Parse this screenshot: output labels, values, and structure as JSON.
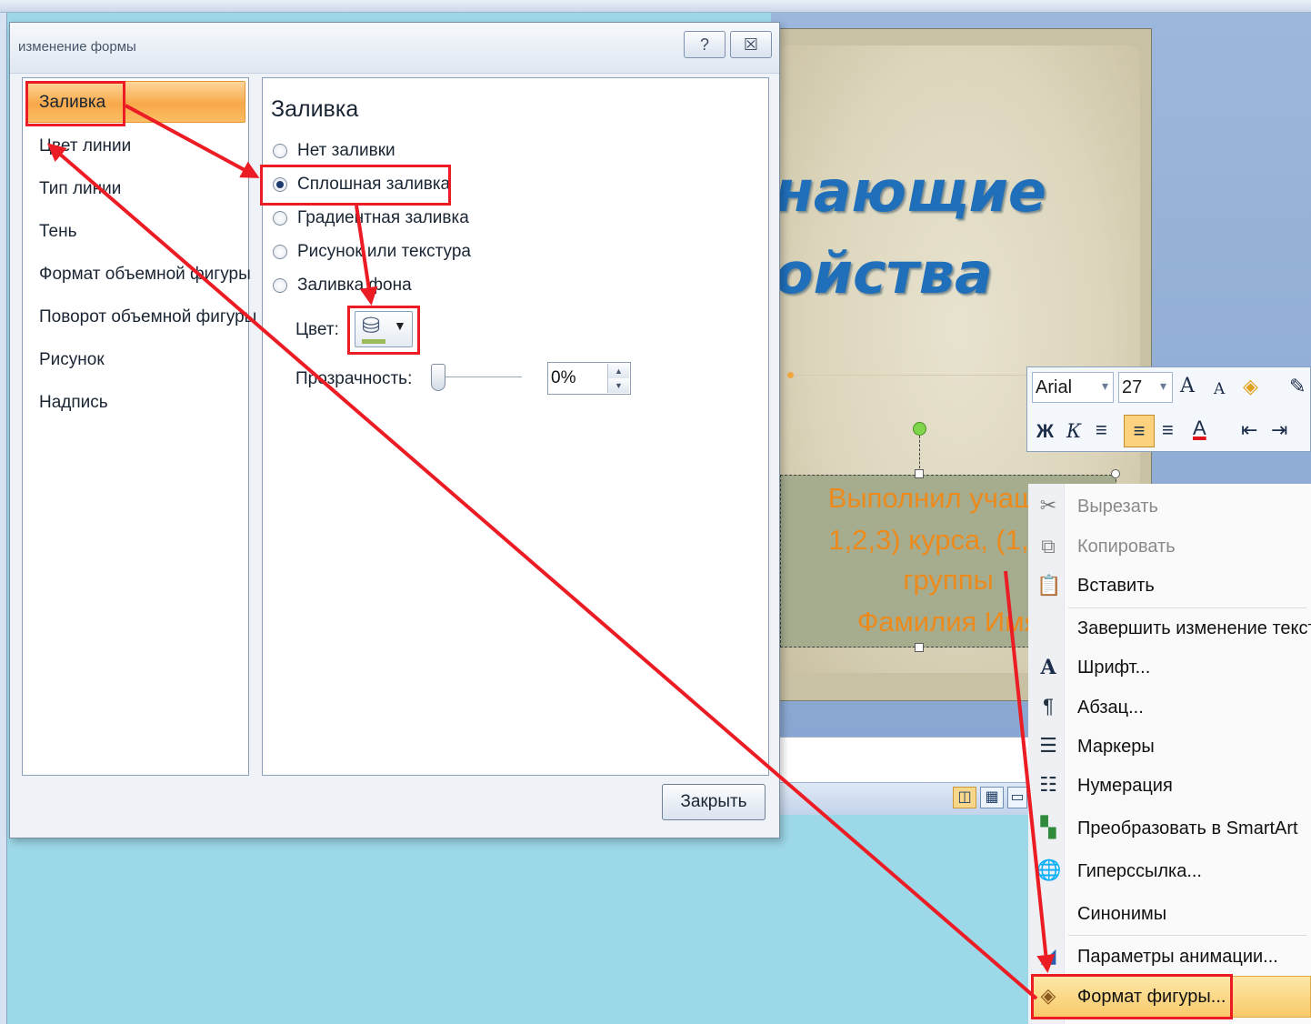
{
  "dialog": {
    "title": "изменение формы",
    "help_btn": "?",
    "close_x": "☒",
    "close_button": "Закрыть",
    "categories": [
      "Заливка",
      "Цвет линии",
      "Тип линии",
      "Тень",
      "Формат объемной фигуры",
      "Поворот объемной фигуры",
      "Рисунок",
      "Надпись"
    ],
    "selected_category": "Заливка",
    "section_heading": "Заливка",
    "fill_options": [
      {
        "label": "Нет заливки",
        "checked": false
      },
      {
        "label": "Сплошная заливка",
        "checked": true
      },
      {
        "label": "Градиентная заливка",
        "checked": false
      },
      {
        "label": "Рисунок или текстура",
        "checked": false
      },
      {
        "label": "Заливка фона",
        "checked": false
      }
    ],
    "color_label": "Цвет:",
    "color_swatch": "#9bbb59",
    "transparency_label": "Прозрачность:",
    "transparency_value": "0%"
  },
  "slide": {
    "title_line1": "нающие",
    "title_line2": "ойства",
    "textbox_lines": [
      "Выполнил учащий",
      "1,2,3) курса, (1,2,3",
      "группы",
      "Фамилия Имя"
    ]
  },
  "mini_toolbar": {
    "font_name": "Arial",
    "font_size": "27",
    "grow_icon": "A",
    "shrink_icon": "A",
    "bold": "Ж",
    "italic": "К",
    "font_color_icon": "A"
  },
  "context_menu": {
    "items": [
      {
        "label": "Вырезать",
        "icon": "scissors-icon",
        "disabled": true
      },
      {
        "label": "Копировать",
        "icon": "copy-icon",
        "disabled": true
      },
      {
        "label": "Вставить",
        "icon": "paste-icon",
        "disabled": false
      },
      {
        "label": "Завершить изменение текста",
        "icon": "",
        "disabled": false
      },
      {
        "label": "Шрифт...",
        "icon": "font-icon",
        "disabled": false
      },
      {
        "label": "Абзац...",
        "icon": "paragraph-icon",
        "disabled": false
      },
      {
        "label": "Маркеры",
        "icon": "bullets-icon",
        "disabled": false
      },
      {
        "label": "Нумерация",
        "icon": "numbering-icon",
        "disabled": false
      },
      {
        "label": "Преобразовать в SmartArt",
        "icon": "smartart-icon",
        "disabled": false
      },
      {
        "label": "Гиперссылка...",
        "icon": "hyperlink-icon",
        "disabled": false
      },
      {
        "label": "Синонимы",
        "icon": "",
        "disabled": false
      },
      {
        "label": "Параметры анимации...",
        "icon": "animation-icon",
        "disabled": false
      },
      {
        "label": "Формат фигуры...",
        "icon": "format-shape-icon",
        "disabled": false
      }
    ],
    "highlighted": "Формат фигуры..."
  },
  "colors": {
    "annotation_red": "#ec1c24",
    "selected_orange": "#f8a84a",
    "title_blue": "#1f6fba",
    "textbox_orange": "#ec8a1c"
  }
}
